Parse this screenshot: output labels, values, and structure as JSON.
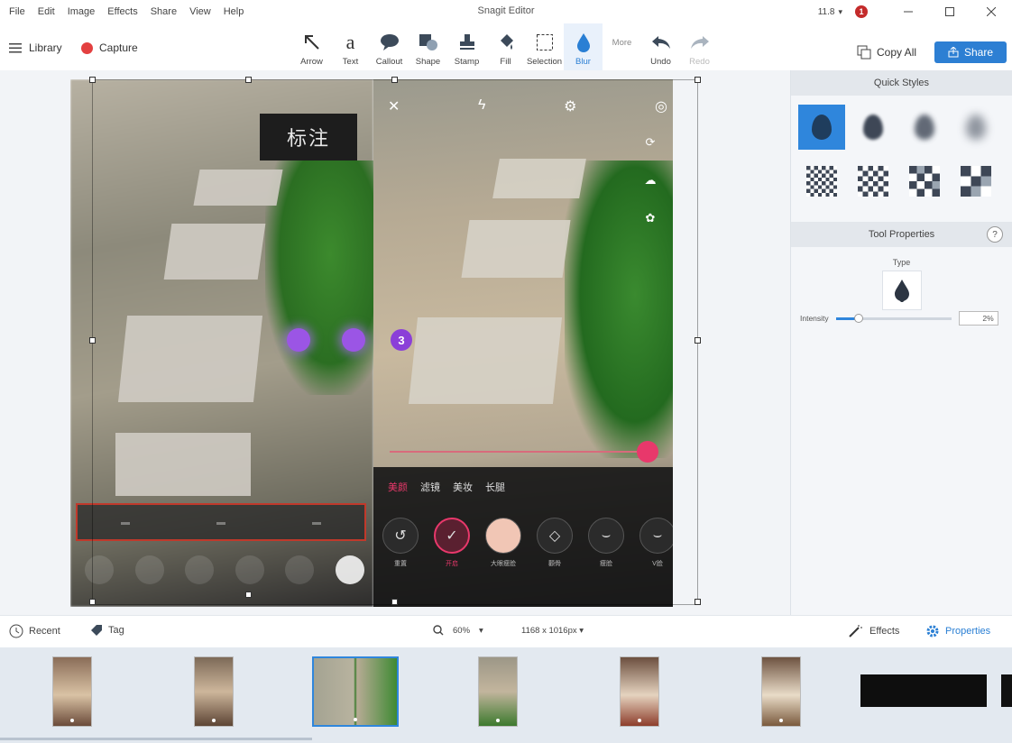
{
  "menu": {
    "items": [
      "File",
      "Edit",
      "Image",
      "Effects",
      "Share",
      "View",
      "Help"
    ],
    "title": "Snagit Editor",
    "user": "11.8",
    "notification_count": "1"
  },
  "toolbar": {
    "library_label": "Library",
    "capture_label": "Capture",
    "tools": [
      {
        "label": "Arrow",
        "icon": "arrow-icon"
      },
      {
        "label": "Text",
        "icon": "text-icon"
      },
      {
        "label": "Callout",
        "icon": "callout-icon"
      },
      {
        "label": "Shape",
        "icon": "shape-icon"
      },
      {
        "label": "Stamp",
        "icon": "stamp-icon"
      },
      {
        "label": "Fill",
        "icon": "fill-icon"
      },
      {
        "label": "Selection",
        "icon": "selection-icon"
      },
      {
        "label": "Blur",
        "icon": "blur-drop-icon",
        "active": true
      }
    ],
    "more_label": "More",
    "undo_label": "Undo",
    "redo_label": "Redo",
    "copy_all_label": "Copy All",
    "share_label": "Share",
    "accent": "#2d7fd3"
  },
  "canvas": {
    "annotation_text": "标注",
    "step_number": "3",
    "beauty_tabs": [
      "美颜",
      "滤镜",
      "美妆",
      "长腿"
    ],
    "beauty_items": [
      {
        "label": "重置",
        "symbol": "↺"
      },
      {
        "label": "开启",
        "symbol": "✓",
        "selected": true
      },
      {
        "label": "大眼瘦脸",
        "symbol": "",
        "face": true
      },
      {
        "label": "颧骨",
        "symbol": "◇"
      },
      {
        "label": "瘦脸",
        "symbol": "⌣"
      },
      {
        "label": "V脸",
        "symbol": "⌣"
      }
    ],
    "side_icons": [
      "⟳",
      "☁",
      "✿"
    ]
  },
  "properties": {
    "quick_styles_title": "Quick Styles",
    "tool_properties_title": "Tool Properties",
    "help_label": "?",
    "type_label": "Type",
    "intensity_label": "Intensity",
    "intensity_value": "2%",
    "intensity_fraction": 0.2,
    "selected_color": "#2f86dc"
  },
  "bottombar": {
    "recent_label": "Recent",
    "tag_label": "Tag",
    "zoom_value": "60%",
    "size_value": "1168 x 1016px",
    "effects_label": "Effects",
    "properties_label": "Properties"
  }
}
